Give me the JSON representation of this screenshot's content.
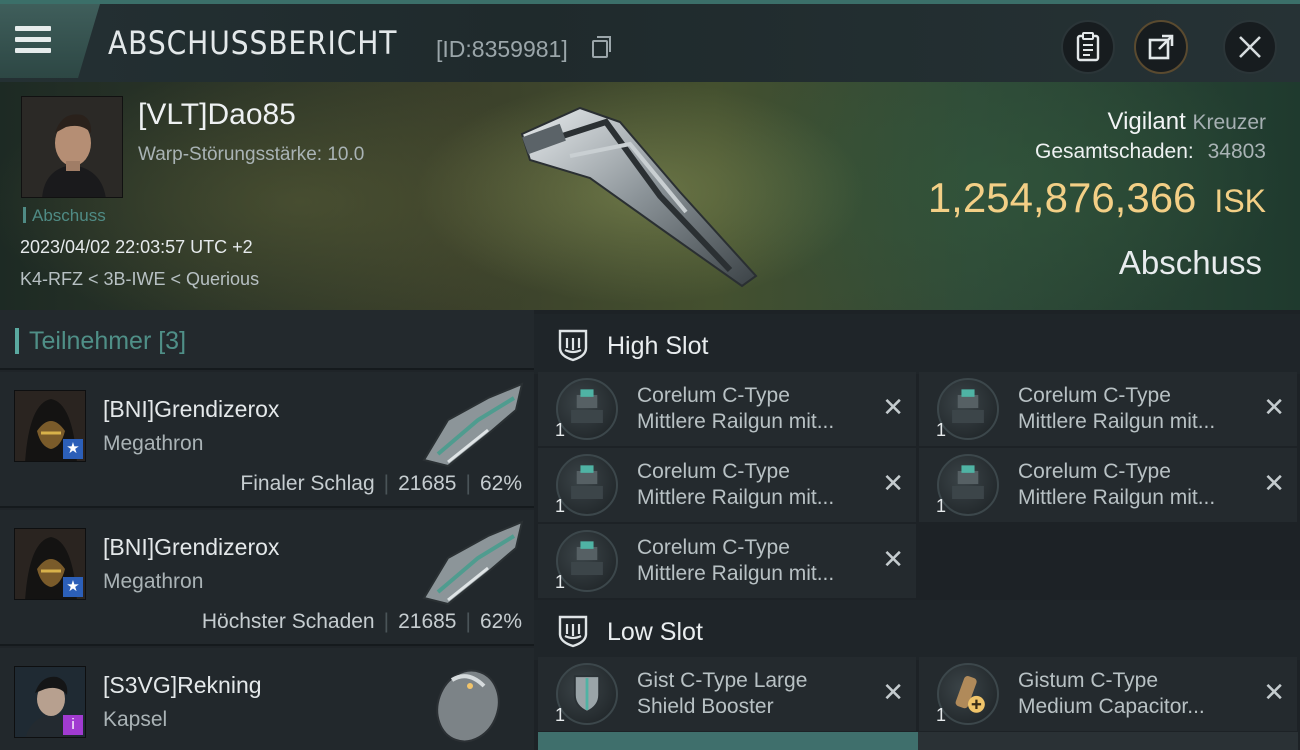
{
  "header": {
    "title": "ABSCHUSSBERICHT",
    "id_text": "[ID:8359981]"
  },
  "victim": {
    "name": "[VLT]Dao85",
    "warp_strength": "Warp-Störungsstärke: 10.0",
    "tag": "Abschuss",
    "datetime": "2023/04/02 22:03:57 UTC +2",
    "location": "K4-RFZ < 3B-IWE < Querious",
    "ship_name": "Vigilant",
    "ship_class": "Kreuzer",
    "damage_label": "Gesamtschaden:",
    "damage_value": "34803",
    "isk_value": "1,254,876,366",
    "isk_unit": "ISK",
    "result": "Abschuss"
  },
  "participants": {
    "label": "Teilnehmer",
    "count": "[3]",
    "rows": [
      {
        "name": "[BNI]Grendizerox",
        "ship": "Megathron",
        "role": "Finaler Schlag",
        "damage": "21685",
        "percent": "62%",
        "badge": "★"
      },
      {
        "name": "[BNI]Grendizerox",
        "ship": "Megathron",
        "role": "Höchster Schaden",
        "damage": "21685",
        "percent": "62%",
        "badge": "★"
      },
      {
        "name": "[S3VG]Rekning",
        "ship": "Kapsel",
        "role": "",
        "damage": "",
        "percent": "",
        "badge": "i"
      }
    ]
  },
  "slots": {
    "high": {
      "label": "High Slot",
      "modules": [
        {
          "qty": "1",
          "line1": "Corelum C-Type",
          "line2": "Mittlere Railgun mit..."
        },
        {
          "qty": "1",
          "line1": "Corelum C-Type",
          "line2": "Mittlere Railgun mit..."
        },
        {
          "qty": "1",
          "line1": "Corelum C-Type",
          "line2": "Mittlere Railgun mit..."
        },
        {
          "qty": "1",
          "line1": "Corelum C-Type",
          "line2": "Mittlere Railgun mit..."
        },
        {
          "qty": "1",
          "line1": "Corelum C-Type",
          "line2": "Mittlere Railgun mit..."
        }
      ]
    },
    "low": {
      "label": "Low Slot",
      "modules": [
        {
          "qty": "1",
          "line1": "Gist C-Type Large",
          "line2": "Shield Booster"
        },
        {
          "qty": "1",
          "line1": "Gistum C-Type",
          "line2": "Medium Capacitor..."
        }
      ]
    },
    "remove_glyph": "✕"
  },
  "colors": {
    "accent_teal": "#4f8f87",
    "isk_gold": "#f3cf86",
    "badge_blue": "#2c5fb8",
    "badge_purple": "#a13bd1"
  }
}
